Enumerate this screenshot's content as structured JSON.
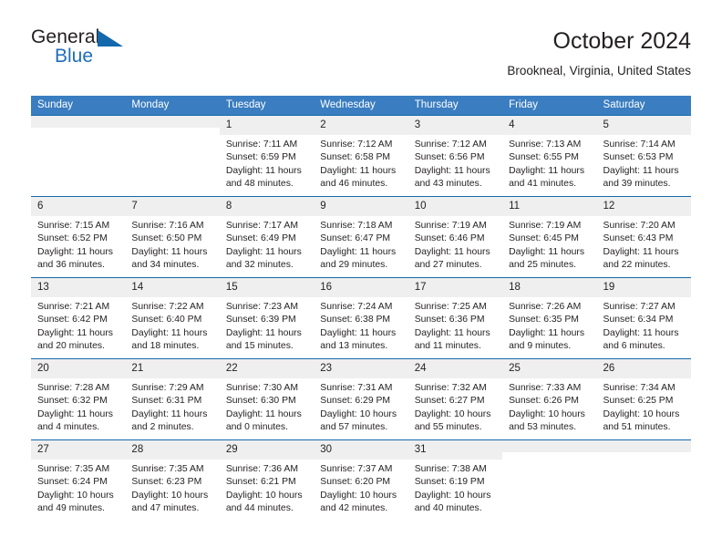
{
  "brand": {
    "word_one": "General",
    "word_two": "Blue",
    "triangle_icon": "triangle-icon",
    "accent_color": "#1369ab"
  },
  "header": {
    "title": "October 2024",
    "location": "Brookneal, Virginia, United States"
  },
  "calendar": {
    "header_bg": "#3a7dc0",
    "row_rule_color": "#1769ad",
    "daynum_bg": "#efefef",
    "weekday_headers": [
      "Sunday",
      "Monday",
      "Tuesday",
      "Wednesday",
      "Thursday",
      "Friday",
      "Saturday"
    ],
    "weeks": [
      [
        {
          "day": "",
          "empty": true,
          "sunrise": "",
          "sunset": "",
          "daylight_1": "",
          "daylight_2": ""
        },
        {
          "day": "",
          "empty": true,
          "sunrise": "",
          "sunset": "",
          "daylight_1": "",
          "daylight_2": ""
        },
        {
          "day": "1",
          "sunrise": "Sunrise: 7:11 AM",
          "sunset": "Sunset: 6:59 PM",
          "daylight_1": "Daylight: 11 hours",
          "daylight_2": "and 48 minutes."
        },
        {
          "day": "2",
          "sunrise": "Sunrise: 7:12 AM",
          "sunset": "Sunset: 6:58 PM",
          "daylight_1": "Daylight: 11 hours",
          "daylight_2": "and 46 minutes."
        },
        {
          "day": "3",
          "sunrise": "Sunrise: 7:12 AM",
          "sunset": "Sunset: 6:56 PM",
          "daylight_1": "Daylight: 11 hours",
          "daylight_2": "and 43 minutes."
        },
        {
          "day": "4",
          "sunrise": "Sunrise: 7:13 AM",
          "sunset": "Sunset: 6:55 PM",
          "daylight_1": "Daylight: 11 hours",
          "daylight_2": "and 41 minutes."
        },
        {
          "day": "5",
          "sunrise": "Sunrise: 7:14 AM",
          "sunset": "Sunset: 6:53 PM",
          "daylight_1": "Daylight: 11 hours",
          "daylight_2": "and 39 minutes."
        }
      ],
      [
        {
          "day": "6",
          "sunrise": "Sunrise: 7:15 AM",
          "sunset": "Sunset: 6:52 PM",
          "daylight_1": "Daylight: 11 hours",
          "daylight_2": "and 36 minutes."
        },
        {
          "day": "7",
          "sunrise": "Sunrise: 7:16 AM",
          "sunset": "Sunset: 6:50 PM",
          "daylight_1": "Daylight: 11 hours",
          "daylight_2": "and 34 minutes."
        },
        {
          "day": "8",
          "sunrise": "Sunrise: 7:17 AM",
          "sunset": "Sunset: 6:49 PM",
          "daylight_1": "Daylight: 11 hours",
          "daylight_2": "and 32 minutes."
        },
        {
          "day": "9",
          "sunrise": "Sunrise: 7:18 AM",
          "sunset": "Sunset: 6:47 PM",
          "daylight_1": "Daylight: 11 hours",
          "daylight_2": "and 29 minutes."
        },
        {
          "day": "10",
          "sunrise": "Sunrise: 7:19 AM",
          "sunset": "Sunset: 6:46 PM",
          "daylight_1": "Daylight: 11 hours",
          "daylight_2": "and 27 minutes."
        },
        {
          "day": "11",
          "sunrise": "Sunrise: 7:19 AM",
          "sunset": "Sunset: 6:45 PM",
          "daylight_1": "Daylight: 11 hours",
          "daylight_2": "and 25 minutes."
        },
        {
          "day": "12",
          "sunrise": "Sunrise: 7:20 AM",
          "sunset": "Sunset: 6:43 PM",
          "daylight_1": "Daylight: 11 hours",
          "daylight_2": "and 22 minutes."
        }
      ],
      [
        {
          "day": "13",
          "sunrise": "Sunrise: 7:21 AM",
          "sunset": "Sunset: 6:42 PM",
          "daylight_1": "Daylight: 11 hours",
          "daylight_2": "and 20 minutes."
        },
        {
          "day": "14",
          "sunrise": "Sunrise: 7:22 AM",
          "sunset": "Sunset: 6:40 PM",
          "daylight_1": "Daylight: 11 hours",
          "daylight_2": "and 18 minutes."
        },
        {
          "day": "15",
          "sunrise": "Sunrise: 7:23 AM",
          "sunset": "Sunset: 6:39 PM",
          "daylight_1": "Daylight: 11 hours",
          "daylight_2": "and 15 minutes."
        },
        {
          "day": "16",
          "sunrise": "Sunrise: 7:24 AM",
          "sunset": "Sunset: 6:38 PM",
          "daylight_1": "Daylight: 11 hours",
          "daylight_2": "and 13 minutes."
        },
        {
          "day": "17",
          "sunrise": "Sunrise: 7:25 AM",
          "sunset": "Sunset: 6:36 PM",
          "daylight_1": "Daylight: 11 hours",
          "daylight_2": "and 11 minutes."
        },
        {
          "day": "18",
          "sunrise": "Sunrise: 7:26 AM",
          "sunset": "Sunset: 6:35 PM",
          "daylight_1": "Daylight: 11 hours",
          "daylight_2": "and 9 minutes."
        },
        {
          "day": "19",
          "sunrise": "Sunrise: 7:27 AM",
          "sunset": "Sunset: 6:34 PM",
          "daylight_1": "Daylight: 11 hours",
          "daylight_2": "and 6 minutes."
        }
      ],
      [
        {
          "day": "20",
          "sunrise": "Sunrise: 7:28 AM",
          "sunset": "Sunset: 6:32 PM",
          "daylight_1": "Daylight: 11 hours",
          "daylight_2": "and 4 minutes."
        },
        {
          "day": "21",
          "sunrise": "Sunrise: 7:29 AM",
          "sunset": "Sunset: 6:31 PM",
          "daylight_1": "Daylight: 11 hours",
          "daylight_2": "and 2 minutes."
        },
        {
          "day": "22",
          "sunrise": "Sunrise: 7:30 AM",
          "sunset": "Sunset: 6:30 PM",
          "daylight_1": "Daylight: 11 hours",
          "daylight_2": "and 0 minutes."
        },
        {
          "day": "23",
          "sunrise": "Sunrise: 7:31 AM",
          "sunset": "Sunset: 6:29 PM",
          "daylight_1": "Daylight: 10 hours",
          "daylight_2": "and 57 minutes."
        },
        {
          "day": "24",
          "sunrise": "Sunrise: 7:32 AM",
          "sunset": "Sunset: 6:27 PM",
          "daylight_1": "Daylight: 10 hours",
          "daylight_2": "and 55 minutes."
        },
        {
          "day": "25",
          "sunrise": "Sunrise: 7:33 AM",
          "sunset": "Sunset: 6:26 PM",
          "daylight_1": "Daylight: 10 hours",
          "daylight_2": "and 53 minutes."
        },
        {
          "day": "26",
          "sunrise": "Sunrise: 7:34 AM",
          "sunset": "Sunset: 6:25 PM",
          "daylight_1": "Daylight: 10 hours",
          "daylight_2": "and 51 minutes."
        }
      ],
      [
        {
          "day": "27",
          "sunrise": "Sunrise: 7:35 AM",
          "sunset": "Sunset: 6:24 PM",
          "daylight_1": "Daylight: 10 hours",
          "daylight_2": "and 49 minutes."
        },
        {
          "day": "28",
          "sunrise": "Sunrise: 7:35 AM",
          "sunset": "Sunset: 6:23 PM",
          "daylight_1": "Daylight: 10 hours",
          "daylight_2": "and 47 minutes."
        },
        {
          "day": "29",
          "sunrise": "Sunrise: 7:36 AM",
          "sunset": "Sunset: 6:21 PM",
          "daylight_1": "Daylight: 10 hours",
          "daylight_2": "and 44 minutes."
        },
        {
          "day": "30",
          "sunrise": "Sunrise: 7:37 AM",
          "sunset": "Sunset: 6:20 PM",
          "daylight_1": "Daylight: 10 hours",
          "daylight_2": "and 42 minutes."
        },
        {
          "day": "31",
          "sunrise": "Sunrise: 7:38 AM",
          "sunset": "Sunset: 6:19 PM",
          "daylight_1": "Daylight: 10 hours",
          "daylight_2": "and 40 minutes."
        },
        {
          "day": "",
          "empty": true,
          "sunrise": "",
          "sunset": "",
          "daylight_1": "",
          "daylight_2": ""
        },
        {
          "day": "",
          "empty": true,
          "sunrise": "",
          "sunset": "",
          "daylight_1": "",
          "daylight_2": ""
        }
      ]
    ]
  }
}
